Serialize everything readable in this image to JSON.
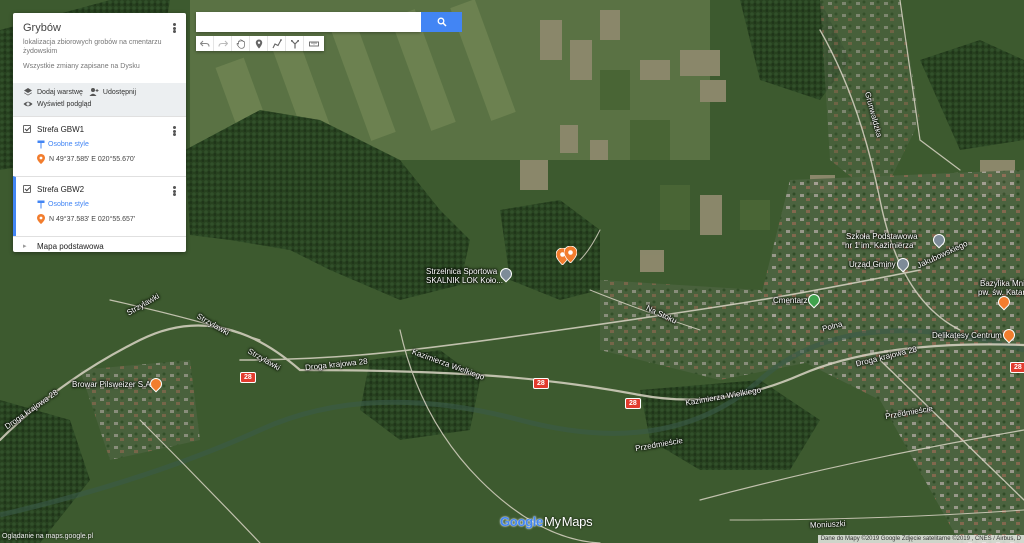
{
  "panel": {
    "title": "Grybów",
    "description": "lokalizacja zbiorowych grobów na cmentarzu żydowskim",
    "status": "Wszystkie zmiany zapisane na Dysku",
    "actions": {
      "add_layer": "Dodaj warstwę",
      "share": "Udostępnij",
      "preview": "Wyświetl podgląd"
    },
    "layers": [
      {
        "name": "Strefa GBW1",
        "style_link": "Osobne style",
        "coords": "N 49°37.585' E 020°55.670'"
      },
      {
        "name": "Strefa GBW2",
        "style_link": "Osobne style",
        "coords": "N 49°37.583' E 020°55.657'"
      }
    ],
    "basemap": "Mapa podstawowa"
  },
  "search": {
    "value": "",
    "placeholder": ""
  },
  "toolbar": {
    "tools": [
      "undo-icon",
      "redo-icon",
      "hand-icon",
      "marker-icon",
      "draw-line-icon",
      "directions-icon",
      "ruler-icon"
    ]
  },
  "map": {
    "labels": {
      "shooting_range": "Strzelnica Sportowa",
      "shooting_range_2": "SKALNIK LOK Koło...",
      "school": "Szkoła Podstawowa",
      "school_2": "nr 1 im. Kazimierza",
      "town_hall": "Urząd Gminy",
      "cemetery": "Cmentarz",
      "brewery": "Browar Pilsweizer S.A.",
      "bazylika": "Bazylika Mni...",
      "bazylika_2": "pw. św. Katar...",
      "delikatesy": "Delikatesy Centrum",
      "road_droga": "Droga krajowa 28",
      "road_droga_left": "Droga krajowa 28",
      "road_droga_right": "Droga krajowa 28",
      "road_kazimierza": "Kazimierza Wielkiego",
      "road_kazimierza_2": "Kazimierza Wielkiego",
      "road_przedmiescie": "Przedmieście",
      "road_przedmiescie_2": "Przedmieście",
      "road_strzylawki": "Strzylawki",
      "road_strzylawki_2": "Strzylawki",
      "road_strzylawki_3": "Strzylawki",
      "road_jakubowskiego": "Jakubowskiego",
      "road_polna": "Polna",
      "road_na_stoku": "Na Stoku",
      "road_grunwaldzka": "Grunwaldzka",
      "road_moniuszki": "Moniuszki",
      "shield": "28"
    }
  },
  "footer": {
    "logo_google": "Google",
    "logo_my": "My",
    "logo_maps": "Maps",
    "viewing_note": "Oglądanie na maps.google.pl",
    "attribution": "Dane do Mapy ©2019 Google Zdjęcie satelitarne ©2019 , CNES / Airbus, D"
  },
  "colors": {
    "accent": "#4285f4",
    "marker": "#f27d2e"
  }
}
